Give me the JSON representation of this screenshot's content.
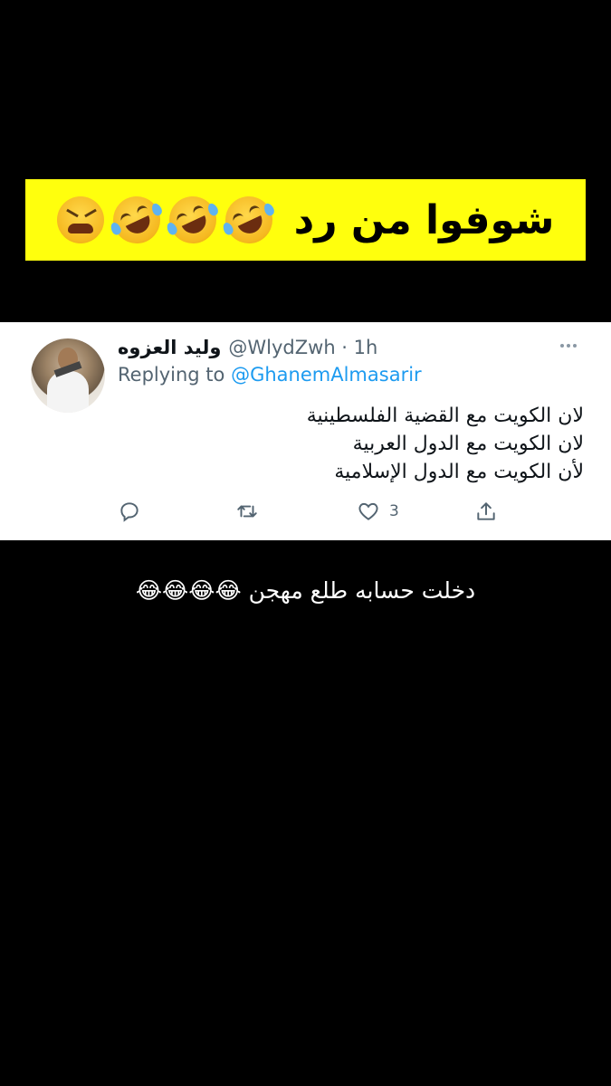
{
  "banner": {
    "text": "شوفوا من رد",
    "emojis": [
      "rolling-on-floor-laughing",
      "rolling-on-floor-laughing",
      "rolling-on-floor-laughing",
      "tired-face"
    ]
  },
  "tweet": {
    "display_name": "وليد العزوه",
    "handle": "@WlydZwh · 1h",
    "replying_label": "Replying to",
    "replying_to": "@GhanemAlmasarir",
    "lines": [
      "لان الكويت مع القضية الفلسطينية",
      "لان الكويت مع الدول العربية",
      "لأن الكويت مع الدول الإسلامية"
    ],
    "like_count": "3"
  },
  "caption": "دخلت حسابه طلع مهجن 😂😂😂😂",
  "colors": {
    "banner_bg": "#ffff0d",
    "link_blue": "#1d9bf0",
    "secondary_text": "#536471"
  }
}
